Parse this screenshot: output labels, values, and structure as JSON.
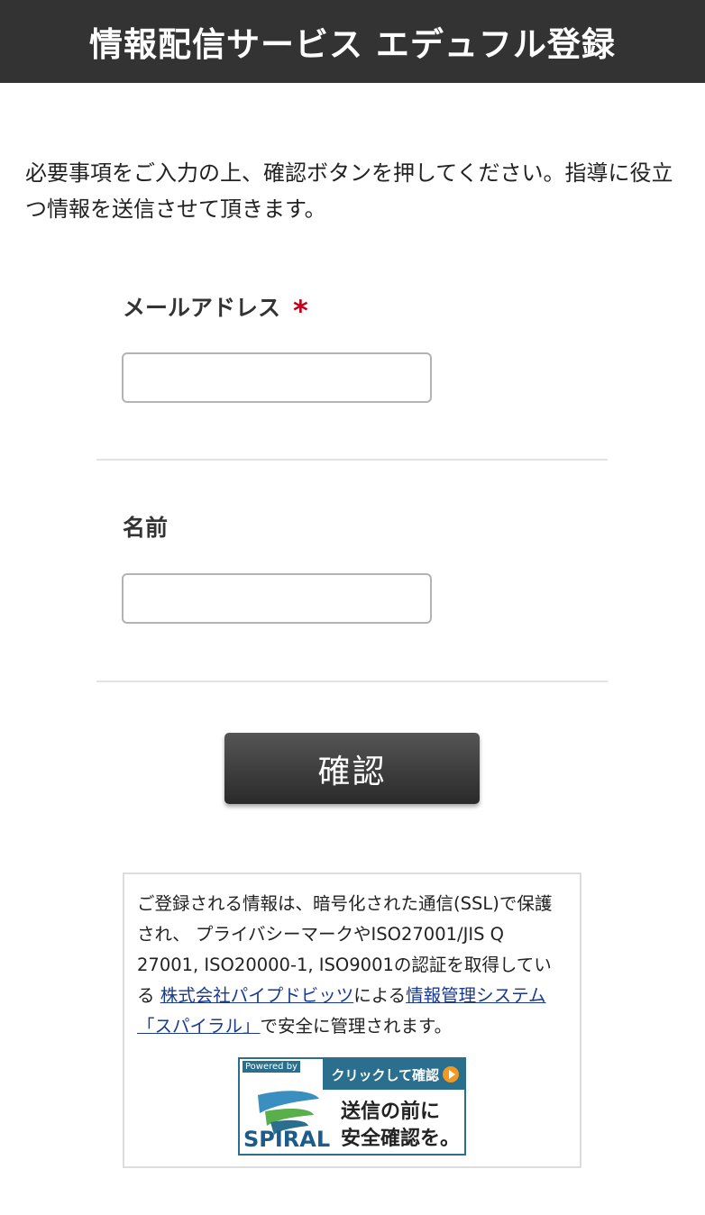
{
  "header": {
    "title": "情報配信サービス エデュフル登録"
  },
  "intro": {
    "text": "必要事項をご入力の上、確認ボタンを押してください。指導に役立つ情報を送信させて頂きます。"
  },
  "form": {
    "email": {
      "label": "メールアドレス",
      "required_mark": "*",
      "value": "",
      "placeholder": ""
    },
    "name": {
      "label": "名前",
      "value": "",
      "placeholder": ""
    },
    "submit_label": "確認"
  },
  "notice": {
    "text_1": "ご登録される情報は、暗号化された通信(SSL)で保護され、 プライバシーマークやISO27001/JIS Q 27001, ISO20000-1, ISO9001の認証を取得している ",
    "link_company": "株式会社パイプドビッツ",
    "text_2": "による",
    "link_system": "情報管理システム「スパイラル」",
    "text_3": "で安全に管理されます。"
  },
  "badge": {
    "powered_by": "Powered by",
    "brand": "SPIRAL",
    "top_label": "クリックして確認",
    "message_line1": "送信の前に",
    "message_line2": "安全確認を。",
    "colors": {
      "frame": "#2a6f8e",
      "arrow": "#f29a1f",
      "brand": "#1d5b8a"
    },
    "icon": "spiral-logo-icon"
  },
  "colors": {
    "header_bg": "#333333",
    "required": "#c0001a",
    "button_bg": "#3a3a3a",
    "link": "#1a3a8f"
  }
}
